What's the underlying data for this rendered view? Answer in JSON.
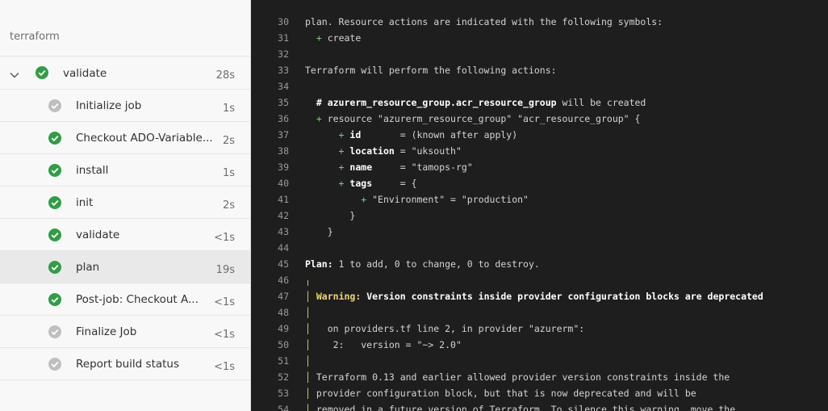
{
  "sidebar": {
    "title": "terraform",
    "job": {
      "label": "validate",
      "duration": "28s",
      "status": "succeeded"
    },
    "steps": [
      {
        "label": "Initialize job",
        "duration": "1s",
        "status": "skipped"
      },
      {
        "label": "Checkout ADO-Variable...",
        "duration": "2s",
        "status": "succeeded"
      },
      {
        "label": "install",
        "duration": "1s",
        "status": "succeeded"
      },
      {
        "label": "init",
        "duration": "2s",
        "status": "succeeded"
      },
      {
        "label": "validate",
        "duration": "<1s",
        "status": "succeeded"
      },
      {
        "label": "plan",
        "duration": "19s",
        "status": "succeeded",
        "selected": true
      },
      {
        "label": "Post-job: Checkout A...",
        "duration": "<1s",
        "status": "succeeded"
      },
      {
        "label": "Finalize Job",
        "duration": "<1s",
        "status": "skipped"
      },
      {
        "label": "Report build status",
        "duration": "<1s",
        "status": "skipped"
      }
    ]
  },
  "colors": {
    "success": "#2f9e44",
    "skipped": "#bfbfbf",
    "plus": "#6bd96b",
    "warning": "#f0d86b"
  },
  "log": {
    "lines": [
      {
        "n": "30",
        "segments": [
          {
            "t": "plan. Resource actions are indicated with the following symbols:"
          }
        ]
      },
      {
        "n": "31",
        "segments": [
          {
            "t": "  "
          },
          {
            "t": "+",
            "c": "plus"
          },
          {
            "t": " create"
          }
        ]
      },
      {
        "n": "32",
        "segments": []
      },
      {
        "n": "33",
        "segments": [
          {
            "t": "Terraform will perform the following actions:"
          }
        ]
      },
      {
        "n": "34",
        "segments": []
      },
      {
        "n": "35",
        "segments": [
          {
            "t": "  "
          },
          {
            "t": "# azurerm_resource_group.acr_resource_group",
            "c": "b"
          },
          {
            "t": " will be created"
          }
        ]
      },
      {
        "n": "36",
        "segments": [
          {
            "t": "  "
          },
          {
            "t": "+",
            "c": "plus"
          },
          {
            "t": " resource \"azurerm_resource_group\" \"acr_resource_group\" {"
          }
        ]
      },
      {
        "n": "37",
        "segments": [
          {
            "t": "      "
          },
          {
            "t": "+",
            "c": "plus"
          },
          {
            "t": " "
          },
          {
            "t": "id",
            "c": "b"
          },
          {
            "t": "       = (known after apply)"
          }
        ]
      },
      {
        "n": "38",
        "segments": [
          {
            "t": "      "
          },
          {
            "t": "+",
            "c": "plus"
          },
          {
            "t": " "
          },
          {
            "t": "location",
            "c": "b"
          },
          {
            "t": " = \"uksouth\""
          }
        ]
      },
      {
        "n": "39",
        "segments": [
          {
            "t": "      "
          },
          {
            "t": "+",
            "c": "plus"
          },
          {
            "t": " "
          },
          {
            "t": "name",
            "c": "b"
          },
          {
            "t": "     = \"tamops-rg\""
          }
        ]
      },
      {
        "n": "40",
        "segments": [
          {
            "t": "      "
          },
          {
            "t": "+",
            "c": "plus"
          },
          {
            "t": " "
          },
          {
            "t": "tags",
            "c": "b"
          },
          {
            "t": "     = {"
          }
        ]
      },
      {
        "n": "41",
        "segments": [
          {
            "t": "          "
          },
          {
            "t": "+",
            "c": "plus"
          },
          {
            "t": " \"Environment\" = \"production\""
          }
        ]
      },
      {
        "n": "42",
        "segments": [
          {
            "t": "        }"
          }
        ]
      },
      {
        "n": "43",
        "segments": [
          {
            "t": "    }"
          }
        ]
      },
      {
        "n": "44",
        "segments": []
      },
      {
        "n": "45",
        "segments": [
          {
            "t": "Plan:",
            "c": "b"
          },
          {
            "t": " 1 to add, 0 to change, 0 to destroy."
          }
        ]
      },
      {
        "n": "46",
        "segments": [
          {
            "t": "╷",
            "c": "bar"
          }
        ]
      },
      {
        "n": "47",
        "segments": [
          {
            "t": "│",
            "c": "bar"
          },
          {
            "t": " "
          },
          {
            "t": "Warning:",
            "c": "warn"
          },
          {
            "t": " "
          },
          {
            "t": "Version constraints inside provider configuration blocks are deprecated",
            "c": "b"
          }
        ]
      },
      {
        "n": "48",
        "segments": [
          {
            "t": "│",
            "c": "bar"
          }
        ]
      },
      {
        "n": "49",
        "segments": [
          {
            "t": "│",
            "c": "bar"
          },
          {
            "t": "   on providers.tf line 2, in provider \"azurerm\":"
          }
        ]
      },
      {
        "n": "50",
        "segments": [
          {
            "t": "│",
            "c": "bar"
          },
          {
            "t": "    2:   version = \"~> 2.0\""
          }
        ]
      },
      {
        "n": "51",
        "segments": [
          {
            "t": "│",
            "c": "bar"
          }
        ]
      },
      {
        "n": "52",
        "segments": [
          {
            "t": "│",
            "c": "bar"
          },
          {
            "t": " Terraform 0.13 and earlier allowed provider version constraints inside the"
          }
        ]
      },
      {
        "n": "53",
        "segments": [
          {
            "t": "│",
            "c": "bar"
          },
          {
            "t": " provider configuration block, but that is now deprecated and will be"
          }
        ]
      },
      {
        "n": "54",
        "segments": [
          {
            "t": "│",
            "c": "bar"
          },
          {
            "t": " removed in a future version of Terraform. To silence this warning, move the"
          }
        ]
      }
    ]
  }
}
